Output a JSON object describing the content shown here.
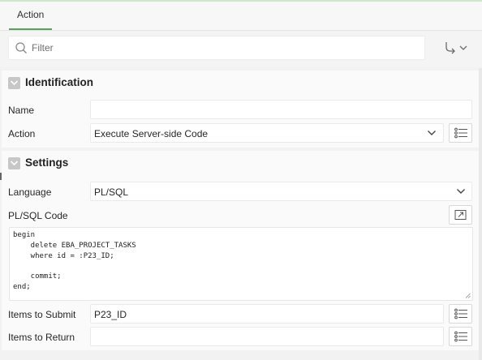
{
  "tabs": [
    {
      "label": "Action"
    }
  ],
  "filter": {
    "placeholder": "Filter",
    "value": ""
  },
  "identification": {
    "title": "Identification",
    "name_label": "Name",
    "name_value": "",
    "action_label": "Action",
    "action_value": "Execute Server-side Code"
  },
  "settings": {
    "title": "Settings",
    "language_label": "Language",
    "language_value": "PL/SQL",
    "code_label": "PL/SQL Code",
    "code": "begin\n    delete EBA_PROJECT_TASKS\n    where id = :P23_ID;\n\n    commit;\nend;",
    "submit_label": "Items to Submit",
    "submit_value": "P23_ID",
    "return_label": "Items to Return",
    "return_value": ""
  },
  "icons": {
    "search": "search-icon",
    "goto": "goto-arrow-icon",
    "collapse": "chevron-down-icon",
    "list": "list-icon",
    "expand": "expand-icon",
    "resize": "resize-grip-icon"
  },
  "colors": {
    "tab_underline": "#5aa05a",
    "top_accent": "#cde7c9"
  }
}
